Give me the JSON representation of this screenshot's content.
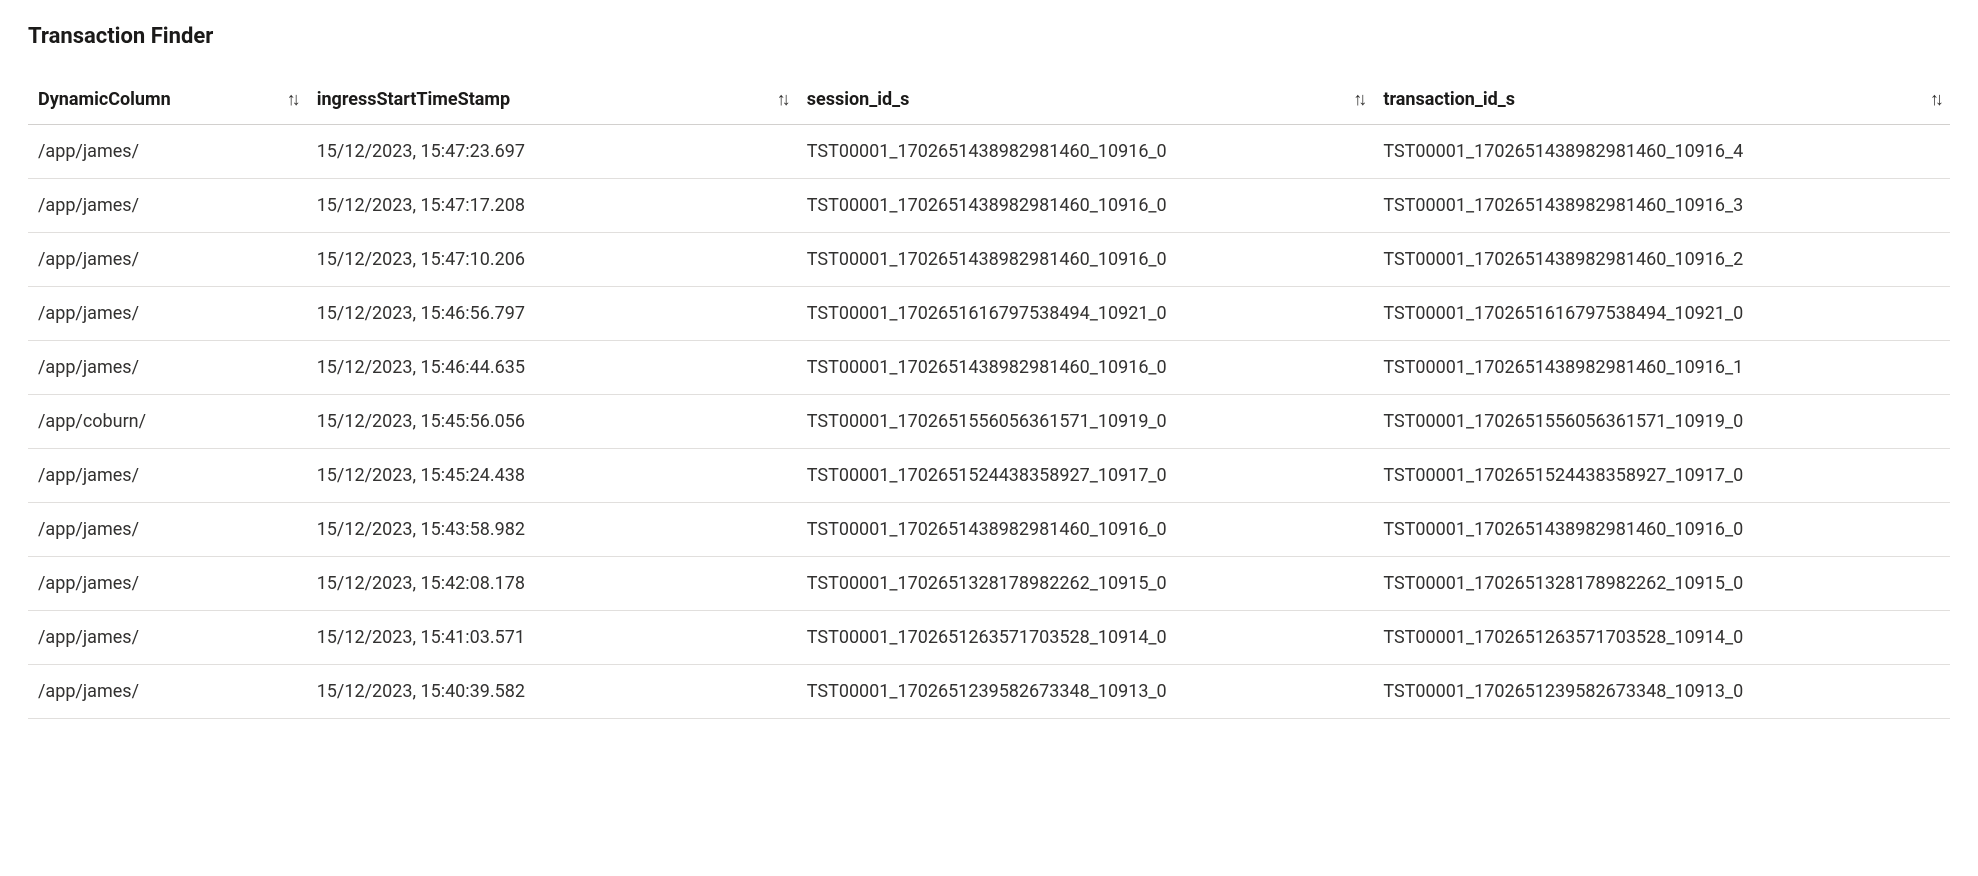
{
  "title": "Transaction Finder",
  "columns": {
    "dynamic": "DynamicColumn",
    "ingress": "ingressStartTimeStamp",
    "session": "session_id_s",
    "transaction": "transaction_id_s"
  },
  "rows": [
    {
      "dynamic": "/app/james/",
      "ingress": "15/12/2023, 15:47:23.697",
      "session": "TST00001_1702651438982981460_10916_0",
      "transaction": "TST00001_1702651438982981460_10916_4"
    },
    {
      "dynamic": "/app/james/",
      "ingress": "15/12/2023, 15:47:17.208",
      "session": "TST00001_1702651438982981460_10916_0",
      "transaction": "TST00001_1702651438982981460_10916_3"
    },
    {
      "dynamic": "/app/james/",
      "ingress": "15/12/2023, 15:47:10.206",
      "session": "TST00001_1702651438982981460_10916_0",
      "transaction": "TST00001_1702651438982981460_10916_2"
    },
    {
      "dynamic": "/app/james/",
      "ingress": "15/12/2023, 15:46:56.797",
      "session": "TST00001_1702651616797538494_10921_0",
      "transaction": "TST00001_1702651616797538494_10921_0"
    },
    {
      "dynamic": "/app/james/",
      "ingress": "15/12/2023, 15:46:44.635",
      "session": "TST00001_1702651438982981460_10916_0",
      "transaction": "TST00001_1702651438982981460_10916_1"
    },
    {
      "dynamic": "/app/coburn/",
      "ingress": "15/12/2023, 15:45:56.056",
      "session": "TST00001_1702651556056361571_10919_0",
      "transaction": "TST00001_1702651556056361571_10919_0"
    },
    {
      "dynamic": "/app/james/",
      "ingress": "15/12/2023, 15:45:24.438",
      "session": "TST00001_1702651524438358927_10917_0",
      "transaction": "TST00001_1702651524438358927_10917_0"
    },
    {
      "dynamic": "/app/james/",
      "ingress": "15/12/2023, 15:43:58.982",
      "session": "TST00001_1702651438982981460_10916_0",
      "transaction": "TST00001_1702651438982981460_10916_0"
    },
    {
      "dynamic": "/app/james/",
      "ingress": "15/12/2023, 15:42:08.178",
      "session": "TST00001_1702651328178982262_10915_0",
      "transaction": "TST00001_1702651328178982262_10915_0"
    },
    {
      "dynamic": "/app/james/",
      "ingress": "15/12/2023, 15:41:03.571",
      "session": "TST00001_1702651263571703528_10914_0",
      "transaction": "TST00001_1702651263571703528_10914_0"
    },
    {
      "dynamic": "/app/james/",
      "ingress": "15/12/2023, 15:40:39.582",
      "session": "TST00001_1702651239582673348_10913_0",
      "transaction": "TST00001_1702651239582673348_10913_0"
    }
  ]
}
